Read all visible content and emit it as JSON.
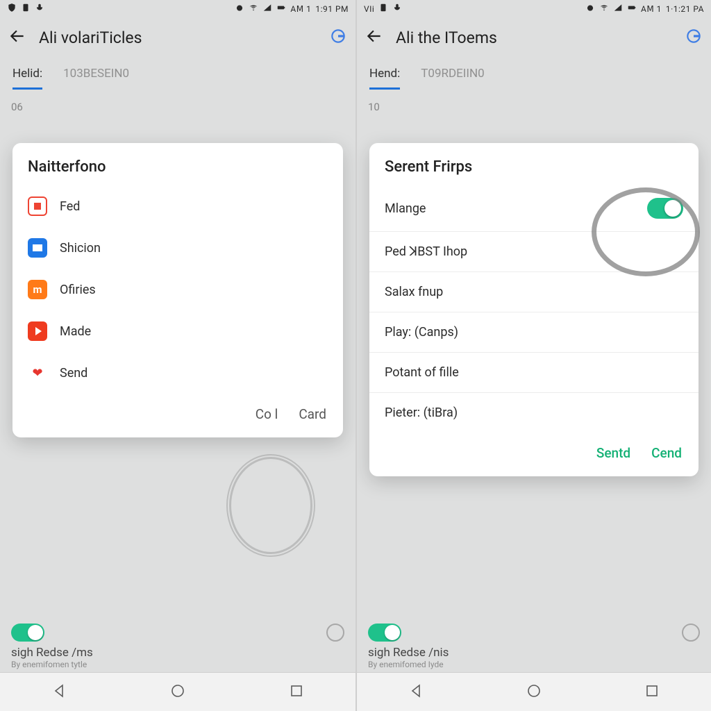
{
  "left": {
    "status": {
      "left_icons": [
        "shield",
        "sim",
        "mic"
      ],
      "time": "1:91 PM",
      "extras": "AⅯ 1"
    },
    "appbar": {
      "title": "Ali volariTicles"
    },
    "tabs": {
      "active": "Helid:",
      "other": "103BESEIN0"
    },
    "bg_label": "06",
    "dialog": {
      "title": "Naitterfono",
      "items": [
        {
          "icon": "red",
          "label": "Fed"
        },
        {
          "icon": "blue",
          "label": "Shicion"
        },
        {
          "icon": "orange",
          "label": "Ofiries"
        },
        {
          "icon": "play",
          "label": "Made"
        },
        {
          "icon": "heart",
          "label": "Send"
        }
      ],
      "actions": {
        "left": "Co l",
        "right": "Card"
      }
    },
    "footer": {
      "title": "sigh Redse /ms",
      "sub": "By enemifomen tytle"
    }
  },
  "right": {
    "status": {
      "left_label": "VIi",
      "time": "1·1:21 PA",
      "extras": "AⅯ 1"
    },
    "appbar": {
      "title": "Ali the IToems"
    },
    "tabs": {
      "active": "Hend:",
      "other": "T09RDEIIN0"
    },
    "bg_label": "10",
    "dialog": {
      "title": "Serent Frirps",
      "items": [
        "Mlange",
        "Ped ꓘBST Ihop",
        "Salax fnup",
        "Play: (Canps)",
        "Potant of fille",
        "Pieter: (tiBra)"
      ],
      "actions": {
        "left": "Sentd",
        "right": "Cend"
      }
    },
    "footer": {
      "title": "sigh Redse /nis",
      "sub": "By enemifomed Iyde"
    }
  }
}
